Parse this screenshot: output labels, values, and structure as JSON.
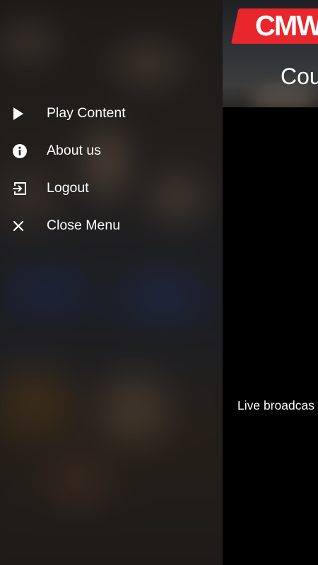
{
  "menu": {
    "items": [
      {
        "label": "Play Content",
        "icon": "play-icon"
      },
      {
        "label": "About us",
        "icon": "info-icon"
      },
      {
        "label": "Logout",
        "icon": "logout-icon"
      },
      {
        "label": "Close Menu",
        "icon": "close-icon"
      }
    ]
  },
  "header": {
    "logo_text": "CMW",
    "title": "Cou"
  },
  "content": {
    "caption": "Live broadcas"
  },
  "colors": {
    "brand_red": "#e8262b",
    "text": "#ffffff",
    "background": "#000000"
  }
}
